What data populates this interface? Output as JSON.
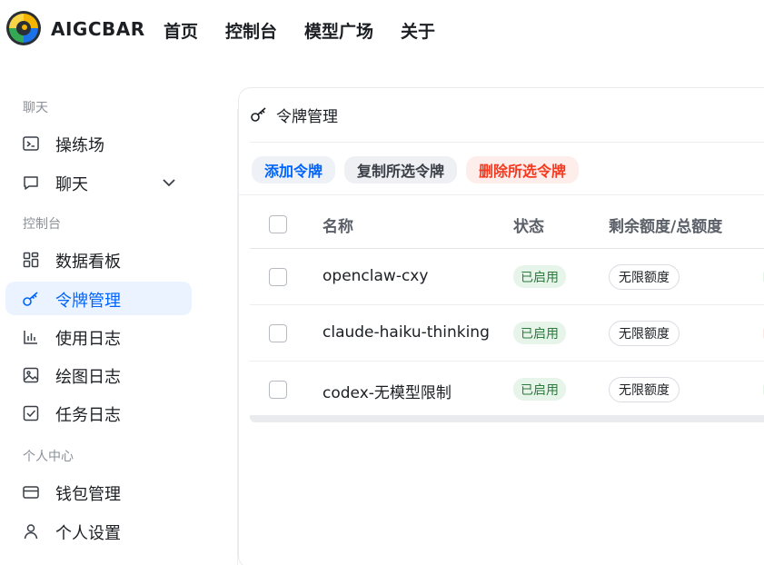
{
  "header": {
    "brand": "AIGCBAR",
    "nav": [
      "首页",
      "控制台",
      "模型广场",
      "关于"
    ]
  },
  "sidebar": {
    "sections": [
      {
        "label": "聊天",
        "items": [
          {
            "label": "操练场",
            "icon": "terminal-icon"
          },
          {
            "label": "聊天",
            "icon": "chat-bubble-icon",
            "expandable": true
          }
        ]
      },
      {
        "label": "控制台",
        "items": [
          {
            "label": "数据看板",
            "icon": "dashboard-grid-icon"
          },
          {
            "label": "令牌管理",
            "icon": "key-icon",
            "active": true
          },
          {
            "label": "使用日志",
            "icon": "bar-chart-icon"
          },
          {
            "label": "绘图日志",
            "icon": "image-icon"
          },
          {
            "label": "任务日志",
            "icon": "checkbox-icon"
          }
        ]
      },
      {
        "label": "个人中心",
        "items": [
          {
            "label": "钱包管理",
            "icon": "credit-card-icon"
          },
          {
            "label": "个人设置",
            "icon": "user-icon"
          }
        ]
      }
    ]
  },
  "card": {
    "title": "令牌管理",
    "actions": {
      "add": "添加令牌",
      "copy": "复制所选令牌",
      "delete": "删除所选令牌"
    },
    "table": {
      "headers": {
        "name": "名称",
        "status": "状态",
        "quota": "剩余额度/总额度"
      },
      "rows": [
        {
          "name": "openclaw-cxy",
          "status": "已启用",
          "quota": "无限额度"
        },
        {
          "name": "claude-haiku-thinking",
          "status": "已启用",
          "quota": "无限额度"
        },
        {
          "name": "codex-无模型限制",
          "status": "已启用",
          "quota": "无限额度"
        }
      ]
    }
  },
  "colors": {
    "accent": "#0064fa",
    "active_bg": "#eaf3ff",
    "danger": "#f5391e",
    "success_bg": "#e6f4ea"
  }
}
